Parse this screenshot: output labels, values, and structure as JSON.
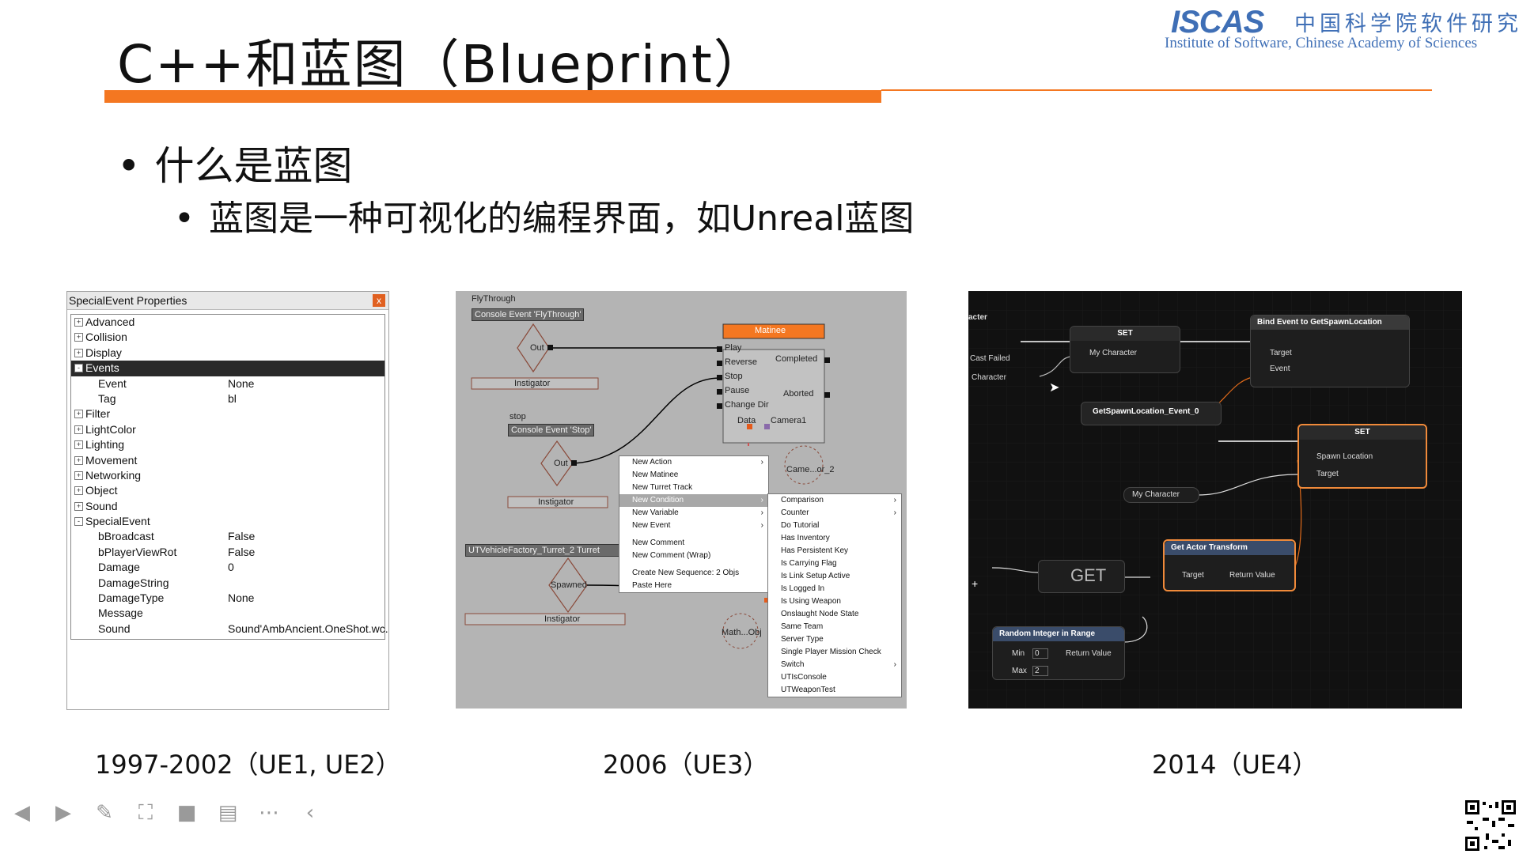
{
  "header": {
    "title": "C++和蓝图（Blueprint）",
    "logo_mark": "ISCAS",
    "logo_cn": "中国科学院软件研究所",
    "logo_en": "Institute of Software, Chinese Academy of Sciences"
  },
  "bullets": {
    "level1": "什么是蓝图",
    "level2": "蓝图是一种可视化的编程界面，如Unreal蓝图"
  },
  "ue1_panel": {
    "title": "SpecialEvent Properties",
    "close": "x",
    "rows": [
      {
        "name": "Advanced",
        "value": "",
        "box": "+",
        "indent": 0
      },
      {
        "name": "Collision",
        "value": "",
        "box": "+",
        "indent": 0
      },
      {
        "name": "Display",
        "value": "",
        "box": "+",
        "indent": 0
      },
      {
        "name": "Events",
        "value": "",
        "box": "-",
        "indent": 0,
        "selected": true
      },
      {
        "name": "Event",
        "value": "None",
        "box": "",
        "indent": 1
      },
      {
        "name": "Tag",
        "value": "bl",
        "box": "",
        "indent": 1
      },
      {
        "name": "Filter",
        "value": "",
        "box": "+",
        "indent": 0
      },
      {
        "name": "LightColor",
        "value": "",
        "box": "+",
        "indent": 0
      },
      {
        "name": "Lighting",
        "value": "",
        "box": "+",
        "indent": 0
      },
      {
        "name": "Movement",
        "value": "",
        "box": "+",
        "indent": 0
      },
      {
        "name": "Networking",
        "value": "",
        "box": "+",
        "indent": 0
      },
      {
        "name": "Object",
        "value": "",
        "box": "+",
        "indent": 0
      },
      {
        "name": "Sound",
        "value": "",
        "box": "+",
        "indent": 0
      },
      {
        "name": "SpecialEvent",
        "value": "",
        "box": "-",
        "indent": 0
      },
      {
        "name": "bBroadcast",
        "value": "False",
        "box": "",
        "indent": 1
      },
      {
        "name": "bPlayerViewRot",
        "value": "False",
        "box": "",
        "indent": 1
      },
      {
        "name": "Damage",
        "value": "0",
        "box": "",
        "indent": 1
      },
      {
        "name": "DamageString",
        "value": "",
        "box": "",
        "indent": 1
      },
      {
        "name": "DamageType",
        "value": "None",
        "box": "",
        "indent": 1
      },
      {
        "name": "Message",
        "value": "",
        "box": "",
        "indent": 1
      },
      {
        "name": "Sound",
        "value": "Sound'AmbAncient.OneShot.wc...",
        "box": "",
        "indent": 1
      }
    ]
  },
  "ue3_panel": {
    "flythrough_label": "FlyThrough",
    "console_event_fly": "Console Event 'FlyThrough'",
    "out1": "Out",
    "instigator1": "Instigator",
    "stop_label": "stop",
    "console_event_stop": "Console Event 'Stop'",
    "out2": "Out",
    "instigator2": "Instigator",
    "vehicle_factory": "UTVehicleFactory_Turret_2 Turret",
    "spawned": "Spawned",
    "instigator3": "Instigator",
    "matinee_title": "Matinee",
    "matinee_inputs": [
      "Play",
      "Reverse",
      "Stop",
      "Pause",
      "Change Dir"
    ],
    "completed": "Completed",
    "aborted": "Aborted",
    "data": "Data",
    "camera1": "Camera1",
    "camera_or_2": "Came...or_2",
    "math_obj": "Math...Obj",
    "context_menu": [
      {
        "label": "New Action",
        "arrow": "›"
      },
      {
        "label": "New Matinee",
        "arrow": ""
      },
      {
        "label": "New Turret Track",
        "arrow": ""
      },
      {
        "label": "New Condition",
        "arrow": "›",
        "highlight": true
      },
      {
        "label": "New Variable",
        "arrow": "›"
      },
      {
        "label": "New Event",
        "arrow": "›"
      },
      {
        "label": "",
        "separator": true
      },
      {
        "label": "New Comment",
        "arrow": ""
      },
      {
        "label": "New Comment (Wrap)",
        "arrow": ""
      },
      {
        "label": "",
        "separator": true
      },
      {
        "label": "Create New Sequence: 2 Objs",
        "arrow": ""
      },
      {
        "label": "Paste Here",
        "arrow": ""
      }
    ],
    "submenu": [
      {
        "label": "Comparison",
        "arrow": "›"
      },
      {
        "label": "Counter",
        "arrow": "›"
      },
      {
        "label": "Do Tutorial",
        "arrow": ""
      },
      {
        "label": "Has Inventory",
        "arrow": ""
      },
      {
        "label": "Has Persistent Key",
        "arrow": ""
      },
      {
        "label": "Is Carrying Flag",
        "arrow": ""
      },
      {
        "label": "Is Link Setup Active",
        "arrow": ""
      },
      {
        "label": "Is Logged In",
        "arrow": ""
      },
      {
        "label": "Is Using Weapon",
        "arrow": ""
      },
      {
        "label": "Onslaught Node State",
        "arrow": ""
      },
      {
        "label": "Same Team",
        "arrow": ""
      },
      {
        "label": "Server Type",
        "arrow": ""
      },
      {
        "label": "Single Player Mission Check",
        "arrow": ""
      },
      {
        "label": "Switch",
        "arrow": "›"
      },
      {
        "label": "UTIsConsole",
        "arrow": ""
      },
      {
        "label": "UTWeaponTest",
        "arrow": ""
      }
    ]
  },
  "ue4_panel": {
    "acter": "acter",
    "cast_failed": "Cast Failed",
    "character": "Character",
    "set_top": "SET",
    "my_character": "My Character",
    "bind_event": "Bind Event to GetSpawnLocation",
    "target_top": "Target",
    "event": "Event",
    "get_spawn_event": "GetSpawnLocation_Event_0",
    "set_right": "SET",
    "spawn_location": "Spawn Location",
    "target_right": "Target",
    "my_character2": "My Character",
    "get_actor_transform": "Get Actor Transform",
    "target_gat": "Target",
    "return_value_gat": "Return Value",
    "get": "GET",
    "random_int": "Random Integer in Range",
    "min": "Min",
    "min_val": "0",
    "max": "Max",
    "max_val": "2",
    "return_value_rand": "Return Value",
    "plus": "+"
  },
  "captions": {
    "ue1": "1997-2002（UE1, UE2）",
    "ue3": "2006（UE3）",
    "ue4": "2014（UE4）"
  },
  "colors": {
    "accent": "#f47721",
    "logo": "#3f6fb6",
    "ue4_highlight": "#f08a3a"
  },
  "toolbar": {
    "icons": [
      "prev-icon",
      "play-icon",
      "pen-icon",
      "screenshot-icon",
      "camera-icon",
      "comment-icon",
      "more-icon",
      "collapse-icon"
    ]
  }
}
